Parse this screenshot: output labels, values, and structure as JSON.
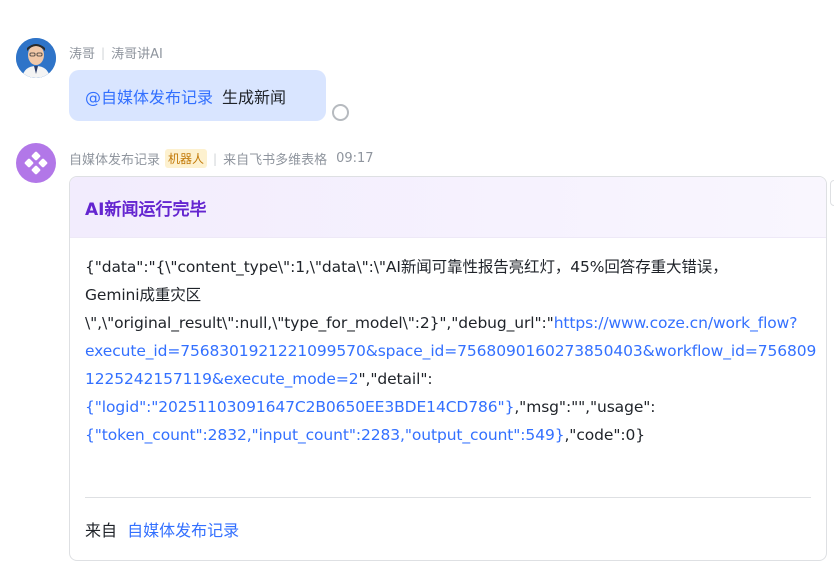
{
  "user_message": {
    "sender": "涛哥",
    "group": "涛哥讲AI",
    "mention": "@自媒体发布记录",
    "text": "生成新闻"
  },
  "bot_message": {
    "sender": "自媒体发布记录",
    "badge": "机器人",
    "source": "来自飞书多维表格",
    "time": "09:17"
  },
  "card": {
    "title": "AI新闻运行完毕",
    "body_lines": [
      "{\"data\":\"{\\\"content_type\\\":1,\\\"data\\\":\\\"AI新闻可靠性报告亮红灯，45%回答存重大错误，",
      "Gemini成重灾区",
      "\\\",\\\"original_result\\\":null,\\\"type_for_model\\\":2}\",\"debug_url\":\""
    ],
    "link_line_1": "https://www.coze.cn/work_flow?",
    "link_line_2": "execute_id=7568301921221099570&space_id=7568090160273850403&workflow_id=756809",
    "link_line_3": "1225242157119&execute_mode=2",
    "tail_line_3": "\",\"detail\":",
    "link_line_4": "{\"logid\":\"20251103091647C2B0650EE3BDE14CD786\"}",
    "tail_line_4": ",\"msg\":\"\",\"usage\":",
    "link_line_5": "{\"token_count\":2832,\"input_count\":2283,\"output_count\":549}",
    "tail_line_5": ",\"code\":0}",
    "footer_prefix": "来自",
    "footer_link": "自媒体发布记录"
  },
  "colors": {
    "link": "#3370ff",
    "card_title": "#6425d0",
    "bubble": "#d9e5ff",
    "bot_avatar": "#b277e8"
  },
  "icons": [
    "user-avatar",
    "bot-avatar-logo",
    "read-status-circle"
  ]
}
